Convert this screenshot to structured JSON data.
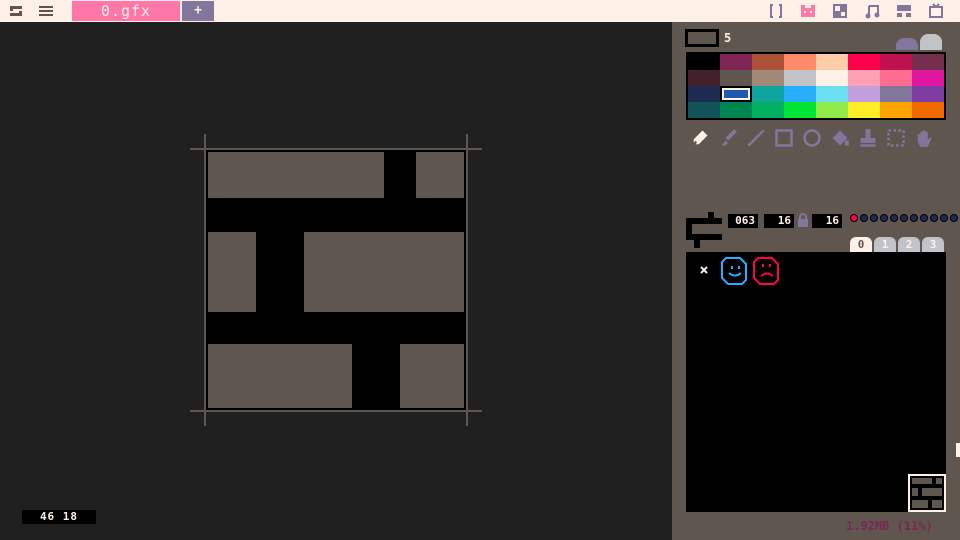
{
  "topbar": {
    "left_icons": [
      "pico-logo-icon",
      "menu-icon"
    ],
    "file_tab": "0.gfx",
    "add_tab": "+",
    "right_icons": [
      "code-icon",
      "sprite-editor-icon",
      "map-editor-icon",
      "music-icon",
      "sfx-icon",
      "screen-icon"
    ],
    "accent": "#ff77a8"
  },
  "colors": {
    "bg": "#202020",
    "panel": "#5f574f",
    "topbar": "#fff1e8",
    "cell": "#5f574f",
    "sheet_bg": "#000000"
  },
  "palette": {
    "current_index": "5",
    "selected": 17,
    "swatches": [
      "#000000",
      "#7e2553",
      "#ab5236",
      "#ff8a6a",
      "#ffccaa",
      "#ff004d",
      "#be1250",
      "#742f4f",
      "#42212d",
      "#5f574f",
      "#a28879",
      "#c2c3c7",
      "#fff1e8",
      "#ffa0b5",
      "#ff6c90",
      "#e1169e",
      "#1d2b53",
      "#1c5cad",
      "#0ea59e",
      "#29adff",
      "#6ce0ef",
      "#c29edf",
      "#83769c",
      "#7e3da0",
      "#125359",
      "#008751",
      "#00b060",
      "#00e436",
      "#90ea4a",
      "#ffec27",
      "#ffa300",
      "#f06a00"
    ]
  },
  "tools": [
    "pencil-icon",
    "brush-icon",
    "line-icon",
    "rectangle-icon",
    "circle-icon",
    "fill-icon",
    "stamp-icon",
    "select-icon",
    "pan-icon"
  ],
  "sprite_fields": {
    "id": "063",
    "width": "16",
    "height": "16"
  },
  "flags": [
    true,
    false,
    false,
    false,
    false,
    false,
    false,
    false,
    false,
    false,
    false,
    false
  ],
  "banks": [
    "0",
    "1",
    "2",
    "3"
  ],
  "active_bank": 0,
  "memory": "1.92MB (11%)",
  "cursor_coords": "46  18"
}
